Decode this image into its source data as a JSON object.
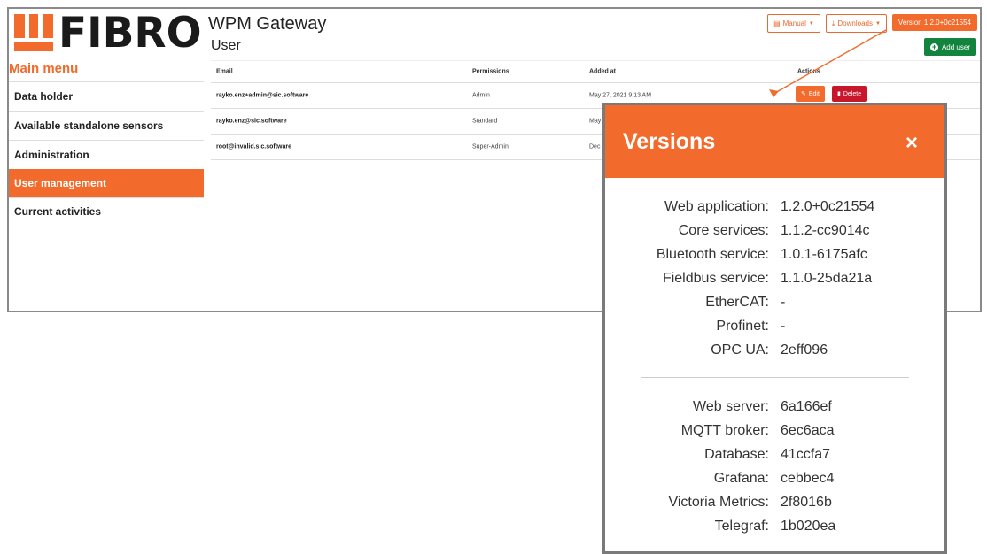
{
  "header": {
    "logo_text": "FIBRO",
    "app_title": "WPM Gateway",
    "page_title": "User",
    "manual_label": "Manual",
    "downloads_label": "Downloads",
    "version_label": "Version 1.2.0+0c21554",
    "add_user_label": "Add user"
  },
  "sidebar": {
    "title": "Main menu",
    "items": [
      {
        "label": "Data holder"
      },
      {
        "label": "Available standalone sensors"
      },
      {
        "label": "Administration"
      },
      {
        "label": "User management"
      },
      {
        "label": "Current activities"
      }
    ]
  },
  "table": {
    "headers": {
      "email": "Email",
      "permissions": "Permissions",
      "added": "Added at",
      "actions": "Actions"
    },
    "rows": [
      {
        "email": "rayko.enz+admin@sic.software",
        "permissions": "Admin",
        "added": "May 27, 2021 9:13 AM",
        "edit": "Edit",
        "delete": "Delete"
      },
      {
        "email": "rayko.enz@sic.software",
        "permissions": "Standard",
        "added": "May"
      },
      {
        "email": "root@invalid.sic.software",
        "permissions": "Super-Admin",
        "added": "Dec"
      }
    ]
  },
  "modal": {
    "title": "Versions",
    "close_glyph": "×",
    "group1": [
      {
        "label": "Web application:",
        "value": "1.2.0+0c21554"
      },
      {
        "label": "Core services:",
        "value": "1.1.2-cc9014c"
      },
      {
        "label": "Bluetooth service:",
        "value": "1.0.1-6175afc"
      },
      {
        "label": "Fieldbus service:",
        "value": "1.1.0-25da21a"
      },
      {
        "label": "EtherCAT:",
        "value": "-"
      },
      {
        "label": "Profinet:",
        "value": "-"
      },
      {
        "label": "OPC UA:",
        "value": "2eff096"
      }
    ],
    "group2": [
      {
        "label": "Web server:",
        "value": "6a166ef"
      },
      {
        "label": "MQTT broker:",
        "value": "6ec6aca"
      },
      {
        "label": "Database:",
        "value": "41ccfa7"
      },
      {
        "label": "Grafana:",
        "value": "cebbec4"
      },
      {
        "label": "Victoria Metrics:",
        "value": "2f8016b"
      },
      {
        "label": "Telegraf:",
        "value": "1b020ea"
      }
    ]
  },
  "colors": {
    "brand_orange": "#f26b2c",
    "add_green": "#13843d",
    "delete_red": "#c8172d"
  }
}
